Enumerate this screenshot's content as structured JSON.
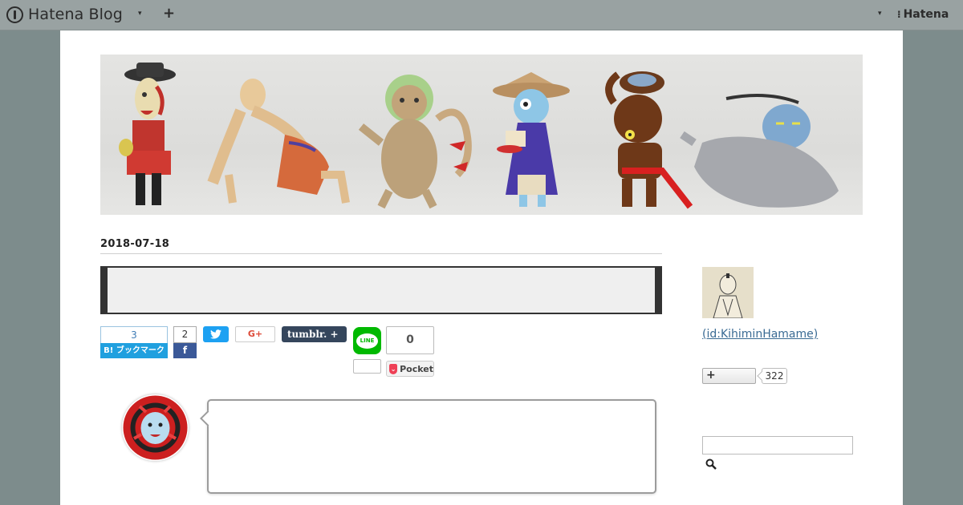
{
  "topbar": {
    "logo_text": "Hatena Blog",
    "caret": "▾",
    "add": "+",
    "right_caret": "▾",
    "hatena_mark": "⫿",
    "hatena_text": "Hatena"
  },
  "article": {
    "date": "2018-07-18"
  },
  "share": {
    "hatebu_count": "3",
    "hatebu_label": "B! ブックマーク",
    "facebook_count": "2",
    "facebook_icon": "f",
    "twitter_icon": "❰",
    "gplus_label": "G+",
    "tumblr_label": "tumblr. +",
    "line_label": "LINE",
    "pocket_count": "0",
    "pocket_label": "Pocket"
  },
  "sidebar": {
    "profile_id": " (id:KihiminHamame)",
    "subscribe_label": "+",
    "subscribe_count": "322",
    "search_value": ""
  },
  "colors": {
    "hatebu": "#20a0df",
    "facebook": "#3b5998",
    "twitter": "#1da1f2",
    "tumblr": "#35465c",
    "line": "#00b900",
    "pocket": "#ef4056"
  }
}
